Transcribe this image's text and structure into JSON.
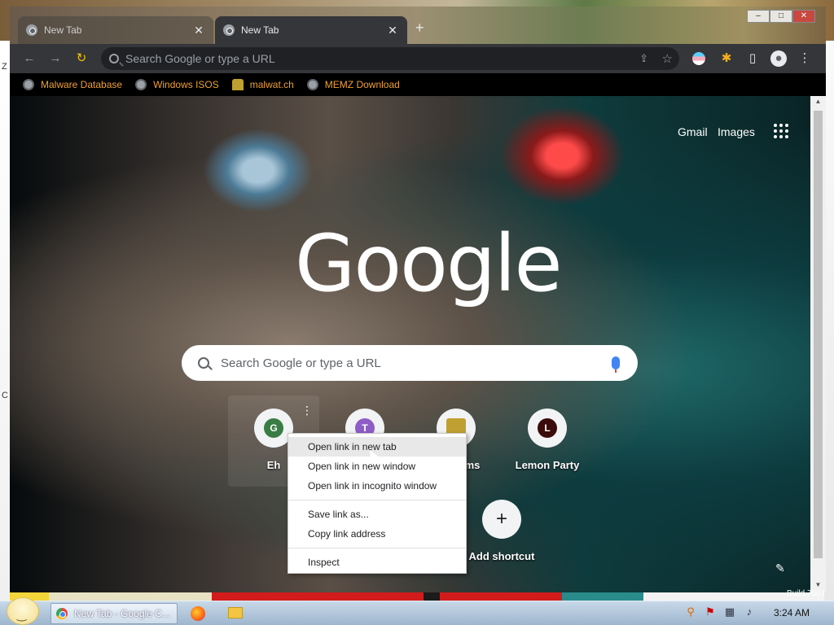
{
  "window": {
    "tabs": [
      {
        "title": "New Tab",
        "active": false
      },
      {
        "title": "New Tab",
        "active": true
      }
    ],
    "new_tab_symbol": "+",
    "controls": {
      "minimize": "–",
      "maximize": "□",
      "close": "✕"
    }
  },
  "omnibox": {
    "placeholder": "Search Google or type a URL"
  },
  "bookmarks": [
    {
      "label": "Malware Database",
      "icon": "globe-icon"
    },
    {
      "label": "Windows ISOS",
      "icon": "globe-icon"
    },
    {
      "label": "malwat.ch",
      "icon": "user-icon"
    },
    {
      "label": "MEMZ Download",
      "icon": "globe-icon"
    }
  ],
  "ntp": {
    "top_links": {
      "gmail": "Gmail",
      "images": "Images"
    },
    "logo": "Google",
    "search_placeholder": "Search Google or type a URL",
    "shortcuts": [
      {
        "label": "Eh",
        "letter": "G",
        "color": "#3a7d44"
      },
      {
        "label": "",
        "letter": "T",
        "color": "#8e5dc6"
      },
      {
        "label": "ms",
        "letter": "",
        "color": "#c0a030"
      },
      {
        "label": "Lemon Party",
        "letter": "L",
        "color": "#3b0a0a"
      }
    ],
    "add_shortcut": "Add shortcut"
  },
  "context_menu": {
    "items": [
      "Open link in new tab",
      "Open link in new window",
      "Open link in incognito window",
      "Save link as...",
      "Copy link address",
      "Inspect"
    ]
  },
  "taskbar": {
    "chrome_button": "New Tab - Google C...",
    "clock": "3:24 AM",
    "build": "Build 7601"
  },
  "desktop": {
    "left_edge_text": [
      "Z",
      "C"
    ]
  }
}
